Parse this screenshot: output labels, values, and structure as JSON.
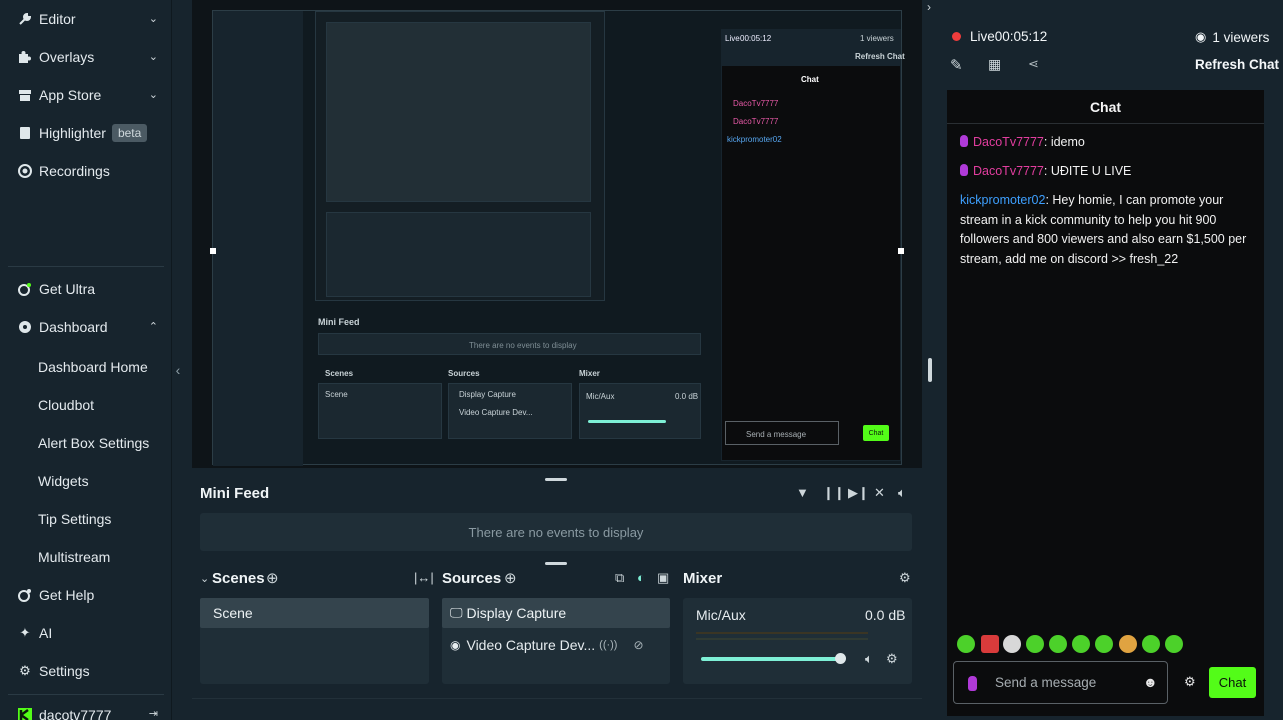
{
  "sidebar": {
    "items": [
      {
        "label": "Editor",
        "icon": "wrench-icon"
      },
      {
        "label": "Overlays",
        "icon": "puzzle-icon"
      },
      {
        "label": "App Store",
        "icon": "store-icon"
      },
      {
        "label": "Highlighter",
        "icon": "highlighter-icon",
        "badge": "beta"
      },
      {
        "label": "Recordings",
        "icon": "record-icon"
      },
      {
        "label": "Get Ultra",
        "icon": "ultra-icon"
      },
      {
        "label": "Dashboard",
        "icon": "dashboard-icon"
      },
      {
        "label": "Get Help",
        "icon": "help-icon"
      },
      {
        "label": "AI",
        "icon": "sparkle-icon"
      },
      {
        "label": "Settings",
        "icon": "gear-icon"
      }
    ],
    "dashboard_sub": [
      "Dashboard Home",
      "Cloudbot",
      "Alert Box Settings",
      "Widgets",
      "Tip Settings",
      "Multistream"
    ],
    "account": "dacotv7777"
  },
  "preview": {
    "live_label": "Live",
    "live_time": "00:05:12",
    "viewers": "1 viewers",
    "refresh": "Refresh Chat",
    "chat_title": "Chat",
    "send_placeholder": "Send a message",
    "chat_button": "Chat",
    "mini_feed": "Mini Feed",
    "no_events": "There are no events to display",
    "scenes": "Scenes",
    "sources": "Sources",
    "mixer": "Mixer",
    "scene": "Scene",
    "display_capture": "Display Capture",
    "video_capture": "Video Capture Dev...",
    "mic_aux": "Mic/Aux",
    "db": "0.0 dB"
  },
  "bottom": {
    "mini_feed_title": "Mini Feed",
    "no_events": "There are no events to display",
    "scenes_title": "Scenes",
    "sources_title": "Sources",
    "mixer_title": "Mixer",
    "scene_item": "Scene",
    "display_capture": "Display Capture",
    "video_capture": "Video Capture Dev...",
    "mic_aux": "Mic/Aux",
    "mic_db": "0.0 dB",
    "mic_volume_fraction": 0.96
  },
  "right": {
    "live_label": "Live",
    "live_time": "00:05:12",
    "viewers": "1 viewers",
    "refresh": "Refresh Chat",
    "chat_title": "Chat",
    "messages": [
      {
        "user": "DacoTv7777",
        "text": ": idemo",
        "color": "pink",
        "mic": true
      },
      {
        "user": "DacoTv7777",
        "text": ": UĐITE U LIVE",
        "color": "pink",
        "mic": true
      },
      {
        "user": "kickpromoter02",
        "text": ": Hey homie, I can promote your stream in a kick community to help you hit 900 followers and 800 viewers and also earn $1,500 per stream, add me on discord >> fresh_22",
        "color": "blue",
        "mic": false
      }
    ],
    "send_placeholder": "Send a message",
    "chat_button": "Chat",
    "colors": {
      "accent": "#53fc18",
      "live": "#ef3c3c",
      "user_pink": "#e33e9f",
      "user_blue": "#3ea0ff"
    }
  }
}
